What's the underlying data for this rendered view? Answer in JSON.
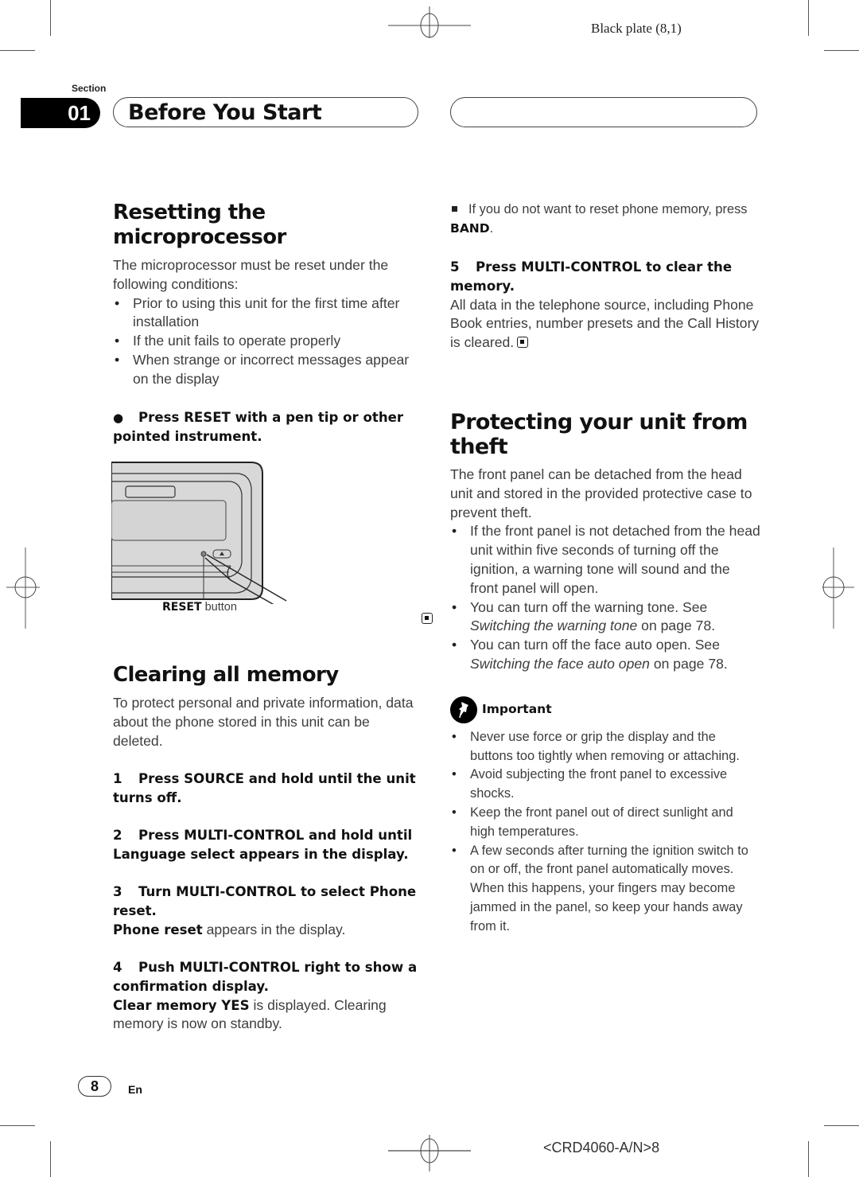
{
  "header": {
    "plate_label": "Black plate (8,1)",
    "section_label": "Section",
    "section_number": "01",
    "section_title": "Before You Start"
  },
  "resetting": {
    "heading": "Resetting the microprocessor",
    "intro": "The microprocessor must be reset under the following conditions:",
    "conditions": [
      "Prior to using this unit for the first time after installation",
      "If the unit fails to operate properly",
      "When strange or incorrect messages appear on the display"
    ],
    "instruction_bullet": "●",
    "instruction": "Press RESET with a pen tip or other pointed instrument.",
    "figure_caption_bold": "RESET",
    "figure_caption_rest": " button"
  },
  "clearing": {
    "heading": "Clearing all memory",
    "intro": "To protect personal and private information, data about the phone stored in this unit can be deleted.",
    "steps": [
      {
        "num": "1",
        "text": "Press SOURCE and hold until the unit turns off."
      },
      {
        "num": "2",
        "text": "Press MULTI-CONTROL and hold until Language select appears in the display."
      },
      {
        "num": "3",
        "text": "Turn MULTI-CONTROL to select Phone reset.",
        "result_bold": "Phone reset",
        "result_rest": " appears in the display."
      },
      {
        "num": "4",
        "text": "Push MULTI-CONTROL right to show a confirmation display.",
        "result_bold": "Clear memory YES",
        "result_rest": " is displayed. Clearing memory is now on standby."
      }
    ],
    "note_prefix": "If you do not want to reset phone memory, press ",
    "note_bold": "BAND",
    "note_suffix": ".",
    "step5": {
      "num": "5",
      "text": "Press MULTI-CONTROL to clear the memory.",
      "result": "All data in the telephone source, including Phone Book entries, number presets and the Call History is cleared."
    }
  },
  "protecting": {
    "heading": "Protecting your unit from theft",
    "intro": "The front panel can be detached from the head unit and stored in the provided protective case to prevent theft.",
    "bullets": [
      {
        "text": "If the front panel is not detached from the head unit within five seconds of turning off the ignition, a warning tone will sound and the front panel will open."
      },
      {
        "text": "You can turn off the warning tone. See ",
        "link": "Switching the warning tone",
        "after": " on page 78."
      },
      {
        "text": "You can turn off the face auto open. See ",
        "link": "Switching the face auto open",
        "after": " on page 78."
      }
    ],
    "important_label": "Important",
    "important_items": [
      "Never use force or grip the display and the buttons too tightly when removing or attaching.",
      "Avoid subjecting the front panel to excessive shocks.",
      "Keep the front panel out of direct sunlight and high temperatures.",
      "A few seconds after turning the ignition switch to on or off, the front panel automatically moves. When this happens, your fingers may become jammed in the panel, so keep your hands away from it."
    ]
  },
  "footer": {
    "page_number": "8",
    "language": "En",
    "doc_code": "<CRD4060-A/N>8"
  }
}
